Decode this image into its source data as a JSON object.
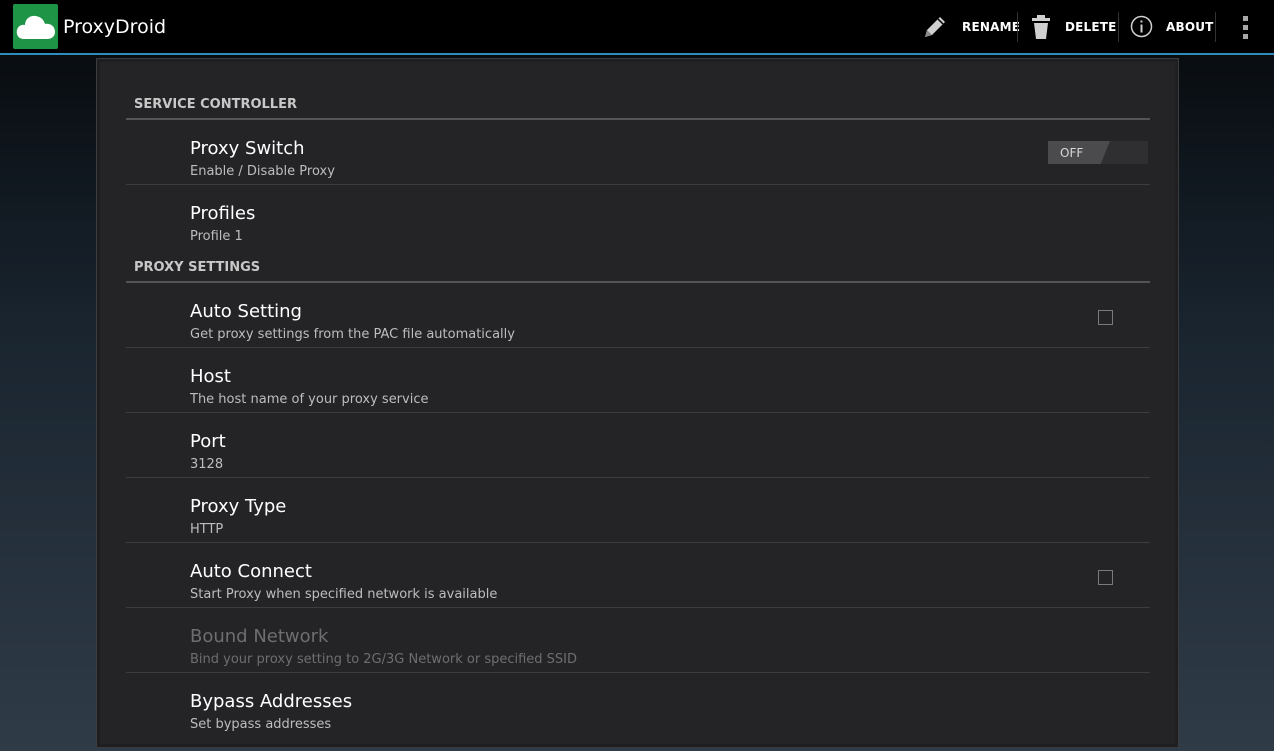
{
  "app": {
    "title": "ProxyDroid",
    "logo_icon": "cloud-icon",
    "brand_color": "#1e9447",
    "accent_color": "#2f8dbd"
  },
  "actionbar": {
    "rename_label": "RENAME",
    "delete_label": "DELETE",
    "about_label": "ABOUT"
  },
  "sections": {
    "service_controller": "SERVICE CONTROLLER",
    "proxy_settings": "PROXY SETTINGS"
  },
  "prefs": {
    "proxy_switch": {
      "title": "Proxy Switch",
      "summary": "Enable / Disable Proxy",
      "toggle_state": "OFF"
    },
    "profiles": {
      "title": "Profiles",
      "summary": "Profile 1"
    },
    "auto_setting": {
      "title": "Auto Setting",
      "summary": "Get proxy settings from the PAC file automatically",
      "checked": false
    },
    "host": {
      "title": "Host",
      "summary": "The host name of your proxy service"
    },
    "port": {
      "title": "Port",
      "summary": "3128"
    },
    "proxy_type": {
      "title": "Proxy Type",
      "summary": "HTTP"
    },
    "auto_connect": {
      "title": "Auto Connect",
      "summary": "Start Proxy when specified network is available",
      "checked": false
    },
    "bound_network": {
      "title": "Bound Network",
      "summary": "Bind your proxy setting to 2G/3G Network or specified SSID",
      "enabled": false
    },
    "bypass_addresses": {
      "title": "Bypass Addresses",
      "summary": "Set bypass addresses"
    }
  }
}
